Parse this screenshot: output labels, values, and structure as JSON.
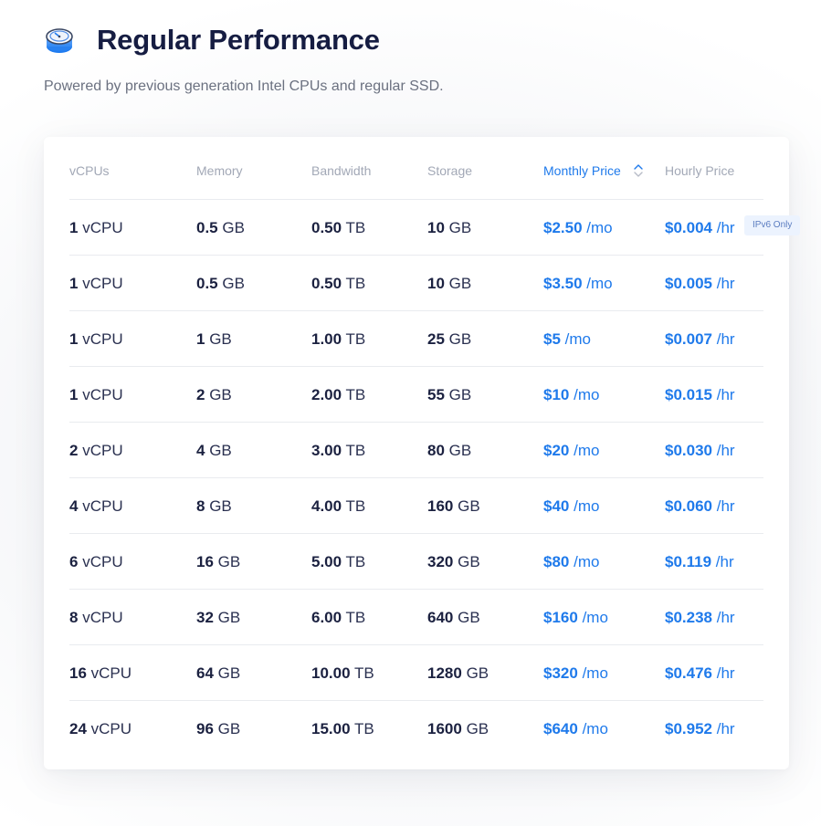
{
  "header": {
    "icon": "performance-gauge-icon",
    "title": "Regular Performance",
    "subtitle": "Powered by previous generation Intel CPUs and regular SSD."
  },
  "colors": {
    "accent": "#1f7aeb",
    "title": "#161d42",
    "header_text": "#a2a8b6",
    "badge_bg": "#ecf3fe"
  },
  "table": {
    "columns": [
      {
        "label": "vCPUs"
      },
      {
        "label": "Memory"
      },
      {
        "label": "Bandwidth"
      },
      {
        "label": "Storage"
      },
      {
        "label": "Monthly Price",
        "sortable": true,
        "active": true
      },
      {
        "label": "Hourly Price"
      }
    ],
    "sort_icon": "sort-up-down-icon",
    "rows": [
      {
        "vcpu_num": "1",
        "vcpu_unit": "vCPU",
        "mem_num": "0.5",
        "mem_unit": "GB",
        "bw_num": "0.50",
        "bw_unit": "TB",
        "sto_num": "10",
        "sto_unit": "GB",
        "monthly": "$2.50",
        "monthly_unit": "/mo",
        "hourly": "$0.004",
        "hourly_unit": "/hr",
        "badge": "IPv6 Only"
      },
      {
        "vcpu_num": "1",
        "vcpu_unit": "vCPU",
        "mem_num": "0.5",
        "mem_unit": "GB",
        "bw_num": "0.50",
        "bw_unit": "TB",
        "sto_num": "10",
        "sto_unit": "GB",
        "monthly": "$3.50",
        "monthly_unit": "/mo",
        "hourly": "$0.005",
        "hourly_unit": "/hr"
      },
      {
        "vcpu_num": "1",
        "vcpu_unit": "vCPU",
        "mem_num": "1",
        "mem_unit": "GB",
        "bw_num": "1.00",
        "bw_unit": "TB",
        "sto_num": "25",
        "sto_unit": "GB",
        "monthly": "$5",
        "monthly_unit": "/mo",
        "hourly": "$0.007",
        "hourly_unit": "/hr"
      },
      {
        "vcpu_num": "1",
        "vcpu_unit": "vCPU",
        "mem_num": "2",
        "mem_unit": "GB",
        "bw_num": "2.00",
        "bw_unit": "TB",
        "sto_num": "55",
        "sto_unit": "GB",
        "monthly": "$10",
        "monthly_unit": "/mo",
        "hourly": "$0.015",
        "hourly_unit": "/hr"
      },
      {
        "vcpu_num": "2",
        "vcpu_unit": "vCPU",
        "mem_num": "4",
        "mem_unit": "GB",
        "bw_num": "3.00",
        "bw_unit": "TB",
        "sto_num": "80",
        "sto_unit": "GB",
        "monthly": "$20",
        "monthly_unit": "/mo",
        "hourly": "$0.030",
        "hourly_unit": "/hr"
      },
      {
        "vcpu_num": "4",
        "vcpu_unit": "vCPU",
        "mem_num": "8",
        "mem_unit": "GB",
        "bw_num": "4.00",
        "bw_unit": "TB",
        "sto_num": "160",
        "sto_unit": "GB",
        "monthly": "$40",
        "monthly_unit": "/mo",
        "hourly": "$0.060",
        "hourly_unit": "/hr"
      },
      {
        "vcpu_num": "6",
        "vcpu_unit": "vCPU",
        "mem_num": "16",
        "mem_unit": "GB",
        "bw_num": "5.00",
        "bw_unit": "TB",
        "sto_num": "320",
        "sto_unit": "GB",
        "monthly": "$80",
        "monthly_unit": "/mo",
        "hourly": "$0.119",
        "hourly_unit": "/hr"
      },
      {
        "vcpu_num": "8",
        "vcpu_unit": "vCPU",
        "mem_num": "32",
        "mem_unit": "GB",
        "bw_num": "6.00",
        "bw_unit": "TB",
        "sto_num": "640",
        "sto_unit": "GB",
        "monthly": "$160",
        "monthly_unit": "/mo",
        "hourly": "$0.238",
        "hourly_unit": "/hr"
      },
      {
        "vcpu_num": "16",
        "vcpu_unit": "vCPU",
        "mem_num": "64",
        "mem_unit": "GB",
        "bw_num": "10.00",
        "bw_unit": "TB",
        "sto_num": "1280",
        "sto_unit": "GB",
        "monthly": "$320",
        "monthly_unit": "/mo",
        "hourly": "$0.476",
        "hourly_unit": "/hr"
      },
      {
        "vcpu_num": "24",
        "vcpu_unit": "vCPU",
        "mem_num": "96",
        "mem_unit": "GB",
        "bw_num": "15.00",
        "bw_unit": "TB",
        "sto_num": "1600",
        "sto_unit": "GB",
        "monthly": "$640",
        "monthly_unit": "/mo",
        "hourly": "$0.952",
        "hourly_unit": "/hr"
      }
    ]
  }
}
